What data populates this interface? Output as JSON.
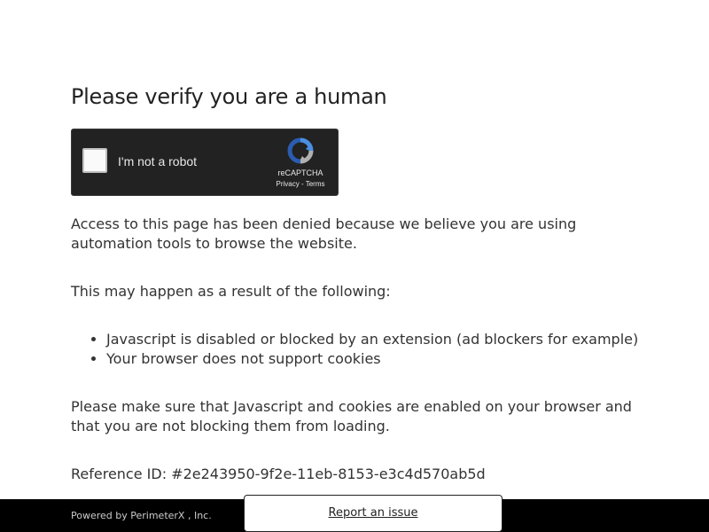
{
  "heading": "Please verify you are a human",
  "captcha": {
    "label": "I'm not a robot",
    "brand": "reCAPTCHA",
    "privacy": "Privacy",
    "separator": " - ",
    "terms": "Terms",
    "logo_icon": "recaptcha-logo-icon"
  },
  "body": {
    "p1": "Access to this page has been denied because we believe you are using automation tools to browse the website.",
    "p2": "This may happen as a result of the following:",
    "reasons": [
      "Javascript is disabled or blocked by an extension (ad blockers for example)",
      "Your browser does not support cookies"
    ],
    "p3": "Please make sure that Javascript and cookies are enabled on your browser and that you are not blocking them from loading.",
    "reference": "Reference ID: #2e243950-9f2e-11eb-8153-e3c4d570ab5d"
  },
  "footer": {
    "powered": "Powered by PerimeterX , Inc.",
    "report": "Report an issue"
  },
  "colors": {
    "captcha_bg": "#222222",
    "footer_bg": "#000000",
    "text": "#333333"
  }
}
